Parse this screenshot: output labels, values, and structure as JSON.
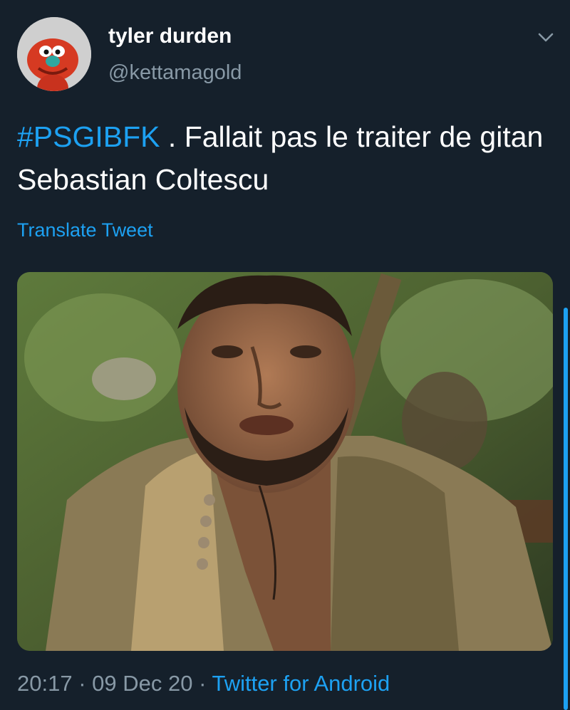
{
  "user": {
    "display_name": "tyler durden",
    "handle": "@kettamagold",
    "avatar_icon": "red-muppet-avatar"
  },
  "tweet": {
    "hashtag": "#PSGIBFK",
    "text": " . Fallait pas le traiter de gitan Sebastian Coltescu",
    "translate_label": "Translate Tweet"
  },
  "media": {
    "icon": "photo-man-bearded-vest"
  },
  "meta": {
    "time": "20:17",
    "separator": " · ",
    "date": "09 Dec 20",
    "source": "Twitter for Android"
  },
  "colors": {
    "background": "#15202b",
    "text": "#ffffff",
    "secondary": "#8899a6",
    "accent": "#1da1f2"
  },
  "icons": {
    "caret": "chevron-down-icon"
  }
}
